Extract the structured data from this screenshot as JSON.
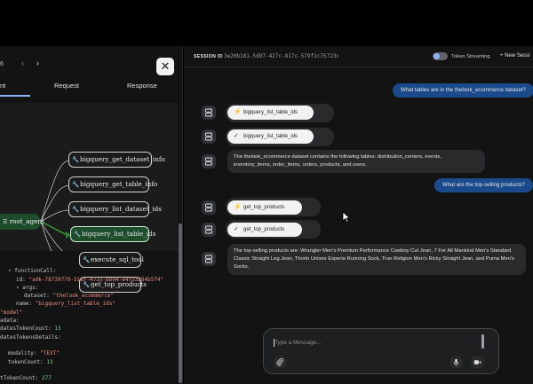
{
  "trace_panel": {
    "event_counter": "6",
    "prev_glyph": "‹",
    "next_glyph": "›",
    "close_glyph": "✕",
    "tabs": [
      {
        "label": "nt",
        "active": true
      },
      {
        "label": "Request",
        "active": false
      },
      {
        "label": "Response",
        "active": false
      }
    ],
    "graph": {
      "root": "root_agent",
      "tools": [
        {
          "label": "bigquery_get_dataset_info",
          "icon": "wrench-icon",
          "active": false
        },
        {
          "label": "bigquery_get_table_info",
          "icon": "wrench-icon",
          "active": false
        },
        {
          "label": "bigquery_list_dataset_ids",
          "icon": "wrench-icon",
          "active": false
        },
        {
          "label": "bigquery_list_table_ids",
          "icon": "wrench-icon",
          "active": true
        },
        {
          "label": "execute_sql_tool",
          "icon": "wrench-icon",
          "active": false
        },
        {
          "label": "get_top_products",
          "icon": "wrench-icon",
          "active": false
        }
      ]
    },
    "code_lines": [
      {
        "indent": 1,
        "tri": "",
        "key": "",
        "val": "",
        "val_type": ""
      },
      {
        "indent": 1,
        "tri": "▾",
        "key": "functionCall:",
        "val": "",
        "val_type": ""
      },
      {
        "indent": 2,
        "tri": "",
        "key": "id:",
        "val": "\"adk-78739779-516f-4723-bb04-e4f33284b5f4\"",
        "val_type": "s"
      },
      {
        "indent": 2,
        "tri": "▾",
        "key": "args:",
        "val": "",
        "val_type": ""
      },
      {
        "indent": 3,
        "tri": "",
        "key": "dataset:",
        "val": "\"thelook_ecommerce\"",
        "val_type": "s"
      },
      {
        "indent": 2,
        "tri": "",
        "key": "name:",
        "val": "\"bigquery_list_table_ids\"",
        "val_type": "s"
      },
      {
        "indent": 0,
        "tri": "",
        "key": "",
        "val": "\"model\"",
        "val_type": "s"
      },
      {
        "indent": 0,
        "tri": "",
        "key": "adata:",
        "val": "",
        "val_type": ""
      },
      {
        "indent": 0,
        "tri": "",
        "key": "datesTokenCount:",
        "val": "13",
        "val_type": "n"
      },
      {
        "indent": 0,
        "tri": "",
        "key": "datesTokensDetails:",
        "val": "",
        "val_type": ""
      },
      {
        "indent": 0,
        "tri": "",
        "key": "",
        "val": "",
        "val_type": ""
      },
      {
        "indent": 1,
        "tri": "",
        "key": "modality:",
        "val": "\"TEXT\"",
        "val_type": "s"
      },
      {
        "indent": 1,
        "tri": "",
        "key": "tokenCount:",
        "val": "13",
        "val_type": "n"
      },
      {
        "indent": 0,
        "tri": "",
        "key": "",
        "val": "",
        "val_type": ""
      },
      {
        "indent": 0,
        "tri": "",
        "key": "tTokenCount:",
        "val": "277",
        "val_type": "n"
      }
    ]
  },
  "chat": {
    "session_label": "SESSION ID",
    "session_id": "3e20b181-5d97-427c-817c-579f1c75723c",
    "token_streaming_label": "Token Streaming",
    "new_session_label": "+ New Sessi",
    "messages": [
      {
        "role": "user",
        "text": "What tables are in the thelook_ecommerce dataset?"
      },
      {
        "role": "tool_call",
        "text": "bigquery_list_table_ids",
        "glyph": "⚡"
      },
      {
        "role": "tool_result",
        "text": "bigquery_list_table_ids",
        "glyph": "✓"
      },
      {
        "role": "bot",
        "text": "The thelook_ecommerce dataset contains the following tables: distribution_centers, events, inventory_items, order_items, orders, products, and users."
      },
      {
        "role": "user",
        "text": "What are the top-selling products?"
      },
      {
        "role": "tool_call",
        "text": "get_top_products",
        "glyph": "⚡"
      },
      {
        "role": "tool_result",
        "text": "get_top_products",
        "glyph": "✓"
      },
      {
        "role": "bot",
        "text": "The top-selling products are: Wrangler Men's Premium Performance Cowboy Cut Jean, 7 For All Mankind Men's Standard Classic Straight Leg Jean, Thorlo Unisex Experia Running Sock, True Religion Men's Ricky Straight Jean, and Puma Men's Socks."
      }
    ],
    "input_placeholder": "Type a Message..."
  },
  "colors": {
    "user_bubble": "#1a4a8b",
    "active_node": "#1e4d2b",
    "accent": "#8ab4f8"
  }
}
